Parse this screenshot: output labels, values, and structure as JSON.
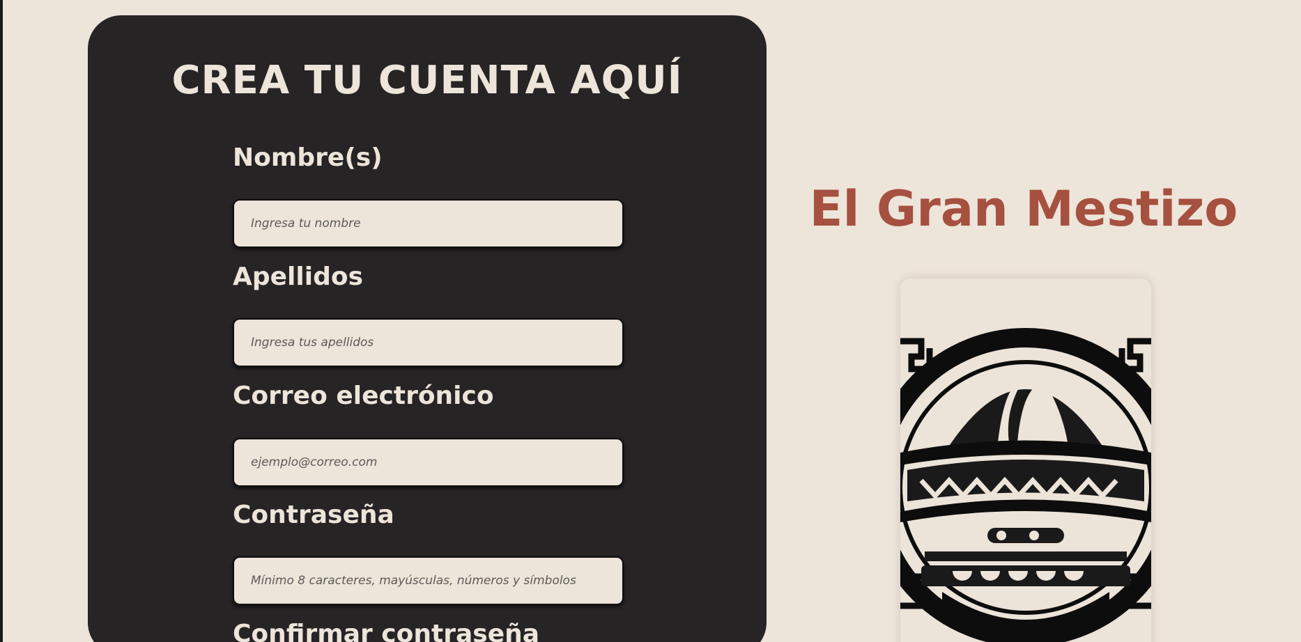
{
  "form": {
    "title": "CREA TU CUENTA AQUÍ",
    "fields": [
      {
        "label": "Nombre(s)",
        "placeholder": "Ingresa tu nombre",
        "value": ""
      },
      {
        "label": "Apellidos",
        "placeholder": "Ingresa tus apellidos",
        "value": ""
      },
      {
        "label": "Correo electrónico",
        "placeholder": "ejemplo@correo.com",
        "value": ""
      },
      {
        "label": "Contraseña",
        "placeholder": "Mínimo 8 caracteres, mayúsculas, números y símbolos",
        "value": ""
      },
      {
        "label": "Confirmar contraseña"
      }
    ]
  },
  "brand": {
    "name": "El Gran Mestizo",
    "logo_icon": "sombrero-mask-logo-icon"
  },
  "colors": {
    "page_background": "#ede4da",
    "card_background": "#262425",
    "card_text": "#ede4da",
    "brand_accent": "#a6503f",
    "input_background": "#ede4da"
  }
}
